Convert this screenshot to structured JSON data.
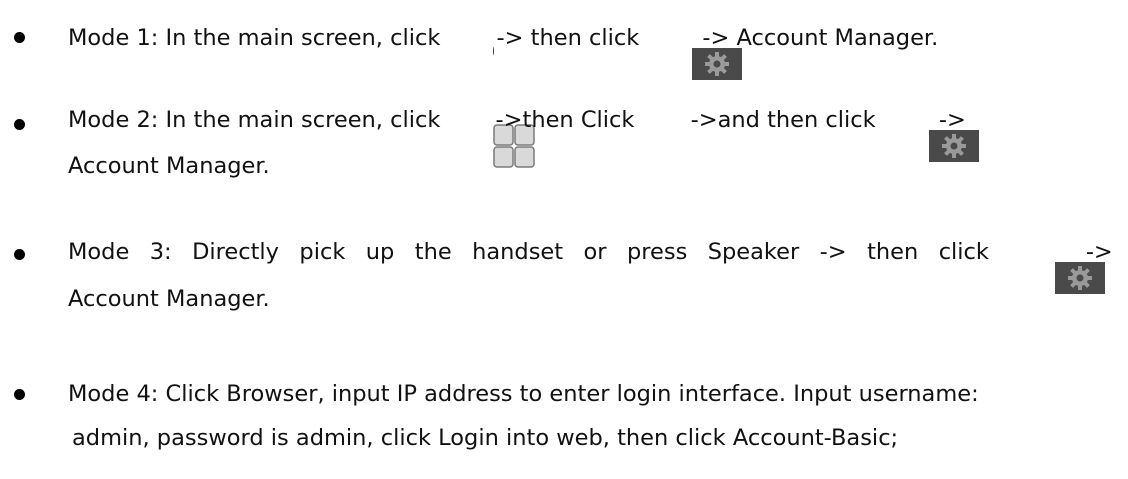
{
  "mode1": {
    "part1": "Mode 1: In the main screen, click ",
    "part2": "-> then click ",
    "part3": "-> Account Manager."
  },
  "mode2": {
    "part1": "Mode 2: In the main screen, click ",
    "part2": "->then Click ",
    "part3": "->and then click ",
    "part4": "->",
    "line2": "Account Manager."
  },
  "mode3": {
    "words": [
      "Mode",
      "3:",
      "Directly",
      "pick",
      "up",
      "the",
      "handset",
      "or",
      "press",
      "Speaker",
      "->",
      "then",
      "click"
    ],
    "tail": "->",
    "line2": "Account Manager."
  },
  "mode4": {
    "line1": "Mode 4: Click Browser, input IP address to enter login interface. Input username:",
    "line2": "admin, password is admin, click Login into web, then click Account-Basic;"
  },
  "icons": [
    "phone-icon",
    "settings-icon",
    "apps-icon"
  ],
  "colors": {
    "phone_green": "#3aa12a",
    "settings_bg": "#4a4a4a",
    "apps_gray": "#cfcfcf"
  }
}
